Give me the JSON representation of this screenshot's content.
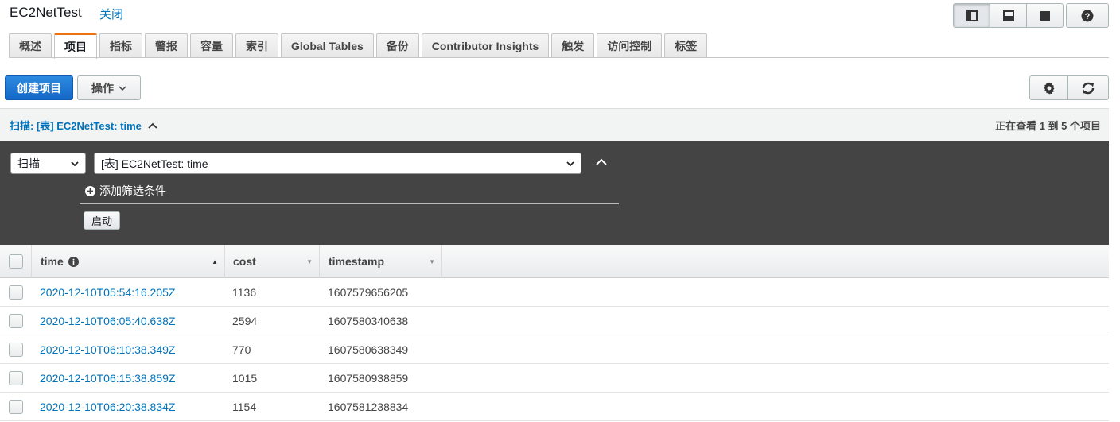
{
  "header": {
    "title": "EC2NetTest",
    "close_label": "关闭"
  },
  "tabs": [
    {
      "label": "概述"
    },
    {
      "label": "项目",
      "active": true
    },
    {
      "label": "指标"
    },
    {
      "label": "警报"
    },
    {
      "label": "容量"
    },
    {
      "label": "索引"
    },
    {
      "label": "Global Tables"
    },
    {
      "label": "备份"
    },
    {
      "label": "Contributor Insights"
    },
    {
      "label": "触发"
    },
    {
      "label": "访问控制"
    },
    {
      "label": "标签"
    }
  ],
  "toolbar": {
    "create_label": "创建项目",
    "actions_label": "操作"
  },
  "scan": {
    "title": "扫描: [表] EC2NetTest: time",
    "status": "正在查看 1 到 5 个项目",
    "mode_value": "扫描",
    "target_value": "[表] EC2NetTest: time",
    "add_filter_label": "添加筛选条件",
    "start_label": "启动"
  },
  "table": {
    "columns": [
      {
        "label": "time"
      },
      {
        "label": "cost"
      },
      {
        "label": "timestamp"
      }
    ],
    "rows": [
      {
        "time": "2020-12-10T05:54:16.205Z",
        "cost": "1136",
        "timestamp": "1607579656205"
      },
      {
        "time": "2020-12-10T06:05:40.638Z",
        "cost": "2594",
        "timestamp": "1607580340638"
      },
      {
        "time": "2020-12-10T06:10:38.349Z",
        "cost": "770",
        "timestamp": "1607580638349"
      },
      {
        "time": "2020-12-10T06:15:38.859Z",
        "cost": "1015",
        "timestamp": "1607580938859"
      },
      {
        "time": "2020-12-10T06:20:38.834Z",
        "cost": "1154",
        "timestamp": "1607581238834"
      }
    ]
  },
  "colors": {
    "accent": "#0073bb",
    "primary": "#1467c7",
    "active_tab": "#ec7211",
    "panel": "#444444"
  }
}
